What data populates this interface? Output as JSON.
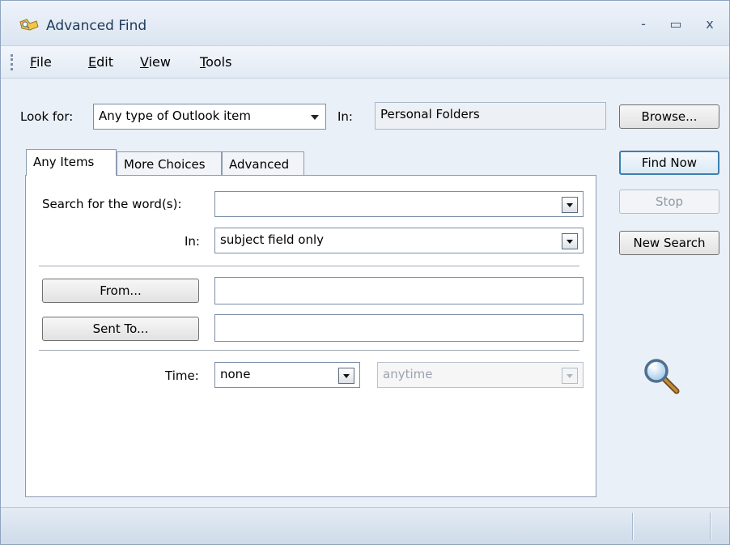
{
  "window": {
    "title": "Advanced Find",
    "controls": {
      "minimize": "-",
      "maximize": "▭",
      "close": "x"
    }
  },
  "menu": {
    "items": [
      {
        "label": "File",
        "mnemonic": "F",
        "rest": "ile"
      },
      {
        "label": "Edit",
        "mnemonic": "E",
        "rest": "dit"
      },
      {
        "label": "View",
        "mnemonic": "V",
        "rest": "iew"
      },
      {
        "label": "Tools",
        "mnemonic": "T",
        "rest": "ools"
      }
    ]
  },
  "lookfor": {
    "label": "Look for:",
    "value": "Any type of Outlook item",
    "in_label": "In:",
    "in_value": "Personal Folders",
    "browse_label": "Browse..."
  },
  "tabs": [
    {
      "label": "Any Items",
      "active": true
    },
    {
      "label": "More Choices",
      "active": false
    },
    {
      "label": "Advanced",
      "active": false
    }
  ],
  "form": {
    "search_label": "Search for the word(s):",
    "search_value": "",
    "in_label": "In:",
    "in_value": "subject field only",
    "from_label": "From...",
    "from_value": "",
    "sentto_label": "Sent To...",
    "sentto_value": "",
    "time_label": "Time:",
    "time_value": "none",
    "time_range_value": "anytime"
  },
  "actions": {
    "find_now": "Find Now",
    "stop": "Stop",
    "new_search": "New Search"
  },
  "icons": {
    "app": "advanced-find-icon",
    "magnifier": "magnifier-icon"
  },
  "colors": {
    "title_text": "#1e395b",
    "window_bg": "#eaf0f7",
    "default_button_border": "#3c7fb1"
  }
}
